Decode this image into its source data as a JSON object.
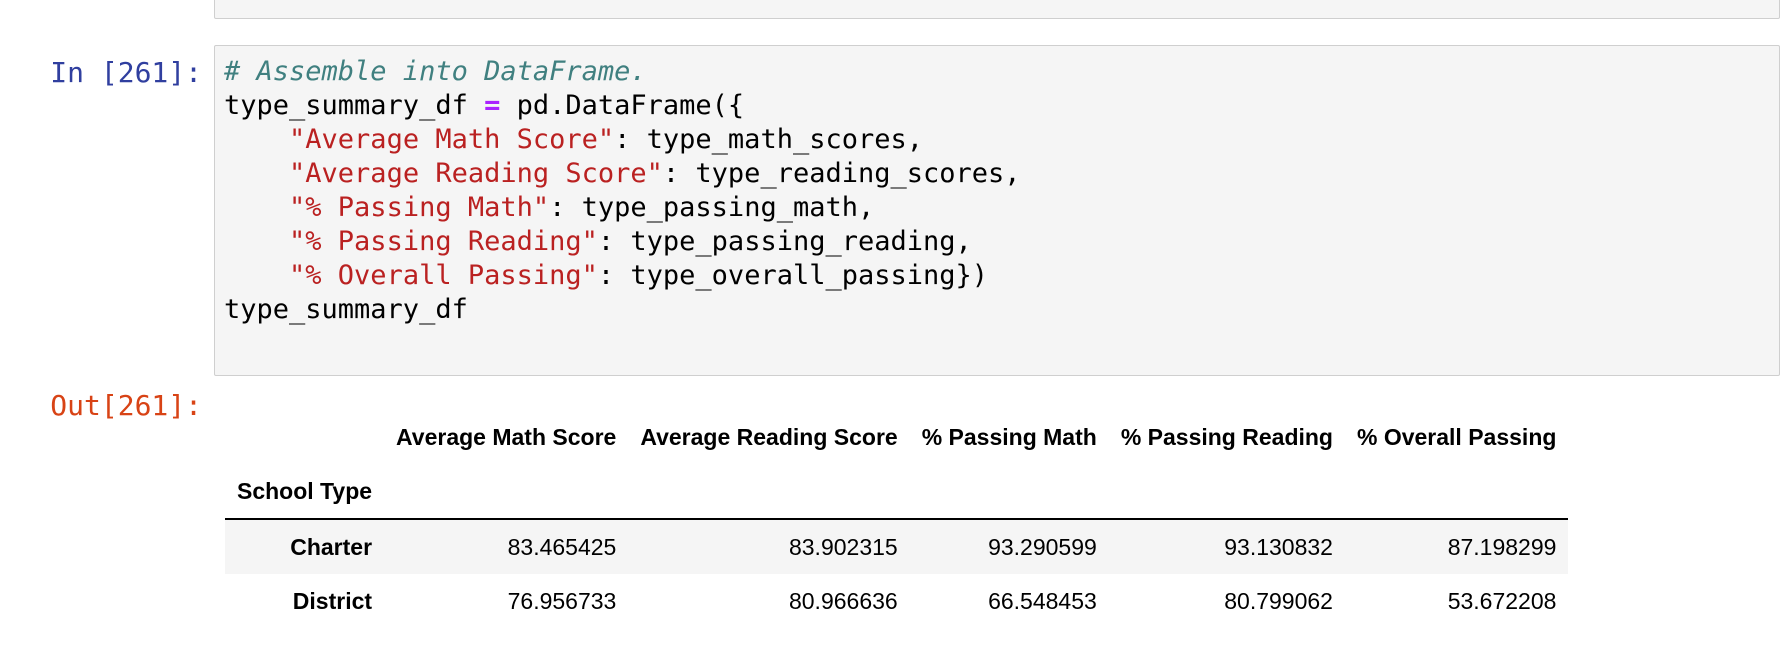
{
  "previous_cell": {},
  "input_cell": {
    "prompt": "In [261]:",
    "code_lines": [
      [
        {
          "t": "c",
          "s": "# Assemble into DataFrame."
        }
      ],
      [
        {
          "t": "n",
          "s": "type_summary_df "
        },
        {
          "t": "o",
          "s": "="
        },
        {
          "t": "n",
          "s": " pd.DataFrame({"
        }
      ],
      [
        {
          "t": "n",
          "s": "    "
        },
        {
          "t": "s",
          "s": "\"Average Math Score\""
        },
        {
          "t": "n",
          "s": ": type_math_scores,"
        }
      ],
      [
        {
          "t": "n",
          "s": "    "
        },
        {
          "t": "s",
          "s": "\"Average Reading Score\""
        },
        {
          "t": "n",
          "s": ": type_reading_scores,"
        }
      ],
      [
        {
          "t": "n",
          "s": "    "
        },
        {
          "t": "s",
          "s": "\"% Passing Math\""
        },
        {
          "t": "n",
          "s": ": type_passing_math,"
        }
      ],
      [
        {
          "t": "n",
          "s": "    "
        },
        {
          "t": "s",
          "s": "\"% Passing Reading\""
        },
        {
          "t": "n",
          "s": ": type_passing_reading,"
        }
      ],
      [
        {
          "t": "n",
          "s": "    "
        },
        {
          "t": "s",
          "s": "\"% Overall Passing\""
        },
        {
          "t": "n",
          "s": ": type_overall_passing})"
        }
      ],
      [
        {
          "t": "n",
          "s": "type_summary_df"
        }
      ]
    ]
  },
  "output_cell": {
    "prompt": "Out[261]:",
    "table": {
      "columns": [
        "Average Math Score",
        "Average Reading Score",
        "% Passing Math",
        "% Passing Reading",
        "% Overall Passing"
      ],
      "index_name": "School Type",
      "rows": [
        {
          "index": "Charter",
          "values": [
            "83.465425",
            "83.902315",
            "93.290599",
            "93.130832",
            "87.198299"
          ]
        },
        {
          "index": "District",
          "values": [
            "76.956733",
            "80.966636",
            "66.548453",
            "80.799062",
            "53.672208"
          ]
        }
      ]
    }
  },
  "colors": {
    "in_prompt": "#303f9f",
    "out_prompt": "#d84315",
    "comment": "#408080",
    "operator": "#aa22ff",
    "string": "#ba2121",
    "cell_background": "#f5f5f5",
    "cell_border": "#cfcfcf"
  }
}
